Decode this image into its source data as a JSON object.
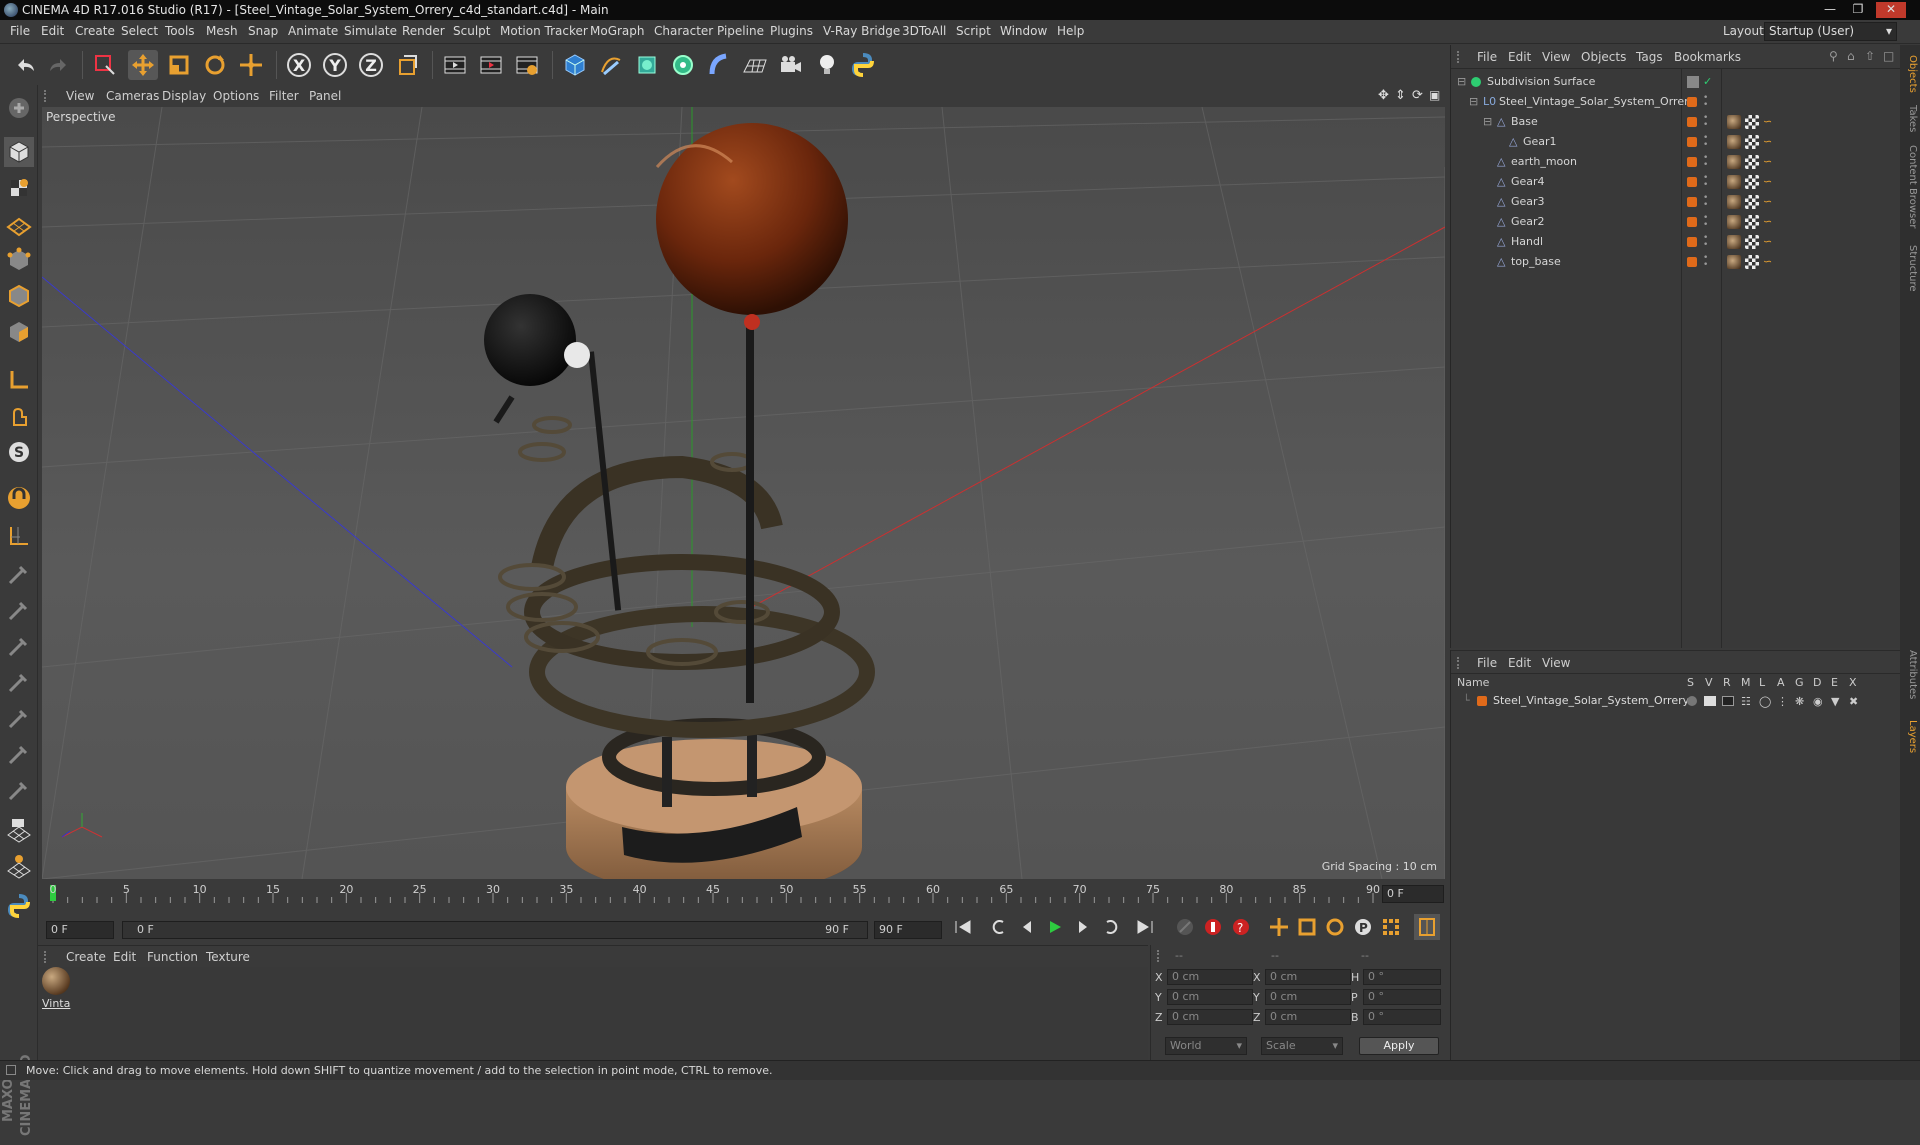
{
  "window": {
    "title": "CINEMA 4D R17.016 Studio (R17) - [Steel_Vintage_Solar_System_Orrery_c4d_standart.c4d] - Main"
  },
  "menubar": {
    "items": [
      "File",
      "Edit",
      "Create",
      "Select",
      "Tools",
      "Mesh",
      "Snap",
      "Animate",
      "Simulate",
      "Render",
      "Sculpt",
      "Motion Tracker",
      "MoGraph",
      "Character",
      "Pipeline",
      "Plugins",
      "V-Ray Bridge",
      "3DToAll",
      "Script",
      "Window",
      "Help"
    ],
    "layout_label": "Layout:",
    "layout_value": "Startup (User)"
  },
  "toolbar": {
    "axis_x": "X",
    "axis_y": "Y",
    "axis_z": "Z"
  },
  "viewport": {
    "menu": [
      "View",
      "Cameras",
      "Display",
      "Options",
      "Filter",
      "Panel"
    ],
    "label": "Perspective",
    "grid_spacing": "Grid Spacing : 10 cm"
  },
  "timeline": {
    "ticks": [
      "0",
      "5",
      "10",
      "15",
      "20",
      "25",
      "30",
      "35",
      "40",
      "45",
      "50",
      "55",
      "60",
      "65",
      "70",
      "75",
      "80",
      "85",
      "90"
    ],
    "current_frame_field": "0 F",
    "start_field": "0 F",
    "range_start": "0 F",
    "range_end": "90 F",
    "end_field": "90 F"
  },
  "material_manager": {
    "menu": [
      "Create",
      "Edit",
      "Function",
      "Texture"
    ],
    "materials": [
      {
        "name": "Vinta"
      }
    ]
  },
  "coordinates": {
    "headers": [
      "--",
      "--",
      "--"
    ],
    "rows": [
      {
        "a": "X",
        "av": "0 cm",
        "b": "X",
        "bv": "0 cm",
        "c": "H",
        "cv": "0 °"
      },
      {
        "a": "Y",
        "av": "0 cm",
        "b": "Y",
        "bv": "0 cm",
        "c": "P",
        "cv": "0 °"
      },
      {
        "a": "Z",
        "av": "0 cm",
        "b": "Z",
        "bv": "0 cm",
        "c": "B",
        "cv": "0 °"
      }
    ],
    "mode1": "World",
    "mode2": "Scale",
    "apply": "Apply"
  },
  "object_manager": {
    "menu": [
      "File",
      "Edit",
      "View",
      "Objects",
      "Tags",
      "Bookmarks"
    ],
    "objects": [
      {
        "name": "Subdivision Surface",
        "indent": 0
      },
      {
        "name": "Steel_Vintage_Solar_System_Orrery",
        "indent": 1
      },
      {
        "name": "Base",
        "indent": 2
      },
      {
        "name": "Gear1",
        "indent": 3
      },
      {
        "name": "earth_moon",
        "indent": 2
      },
      {
        "name": "Gear4",
        "indent": 2
      },
      {
        "name": "Gear3",
        "indent": 2
      },
      {
        "name": "Gear2",
        "indent": 2
      },
      {
        "name": "Handl",
        "indent": 2
      },
      {
        "name": "top_base",
        "indent": 2
      }
    ]
  },
  "layer_manager": {
    "menu": [
      "File",
      "Edit",
      "View"
    ],
    "columns": [
      "Name",
      "S",
      "V",
      "R",
      "M",
      "L",
      "A",
      "G",
      "D",
      "E",
      "X"
    ],
    "layers": [
      {
        "name": "Steel_Vintage_Solar_System_Orrery",
        "color": "#e06a1a"
      }
    ]
  },
  "right_tabs": [
    "Objects",
    "Takes",
    "Content Browser",
    "Structure",
    "Attributes",
    "Layers"
  ],
  "status": {
    "text": "Move: Click and drag to move elements. Hold down SHIFT to quantize movement / add to the selection in point mode, CTRL to remove."
  },
  "brand": {
    "text": "MAXON CINEMA 4D"
  },
  "colors": {
    "accent": "#e8a030",
    "layer_orange": "#e06a1a",
    "sun": "#7a2e10"
  }
}
